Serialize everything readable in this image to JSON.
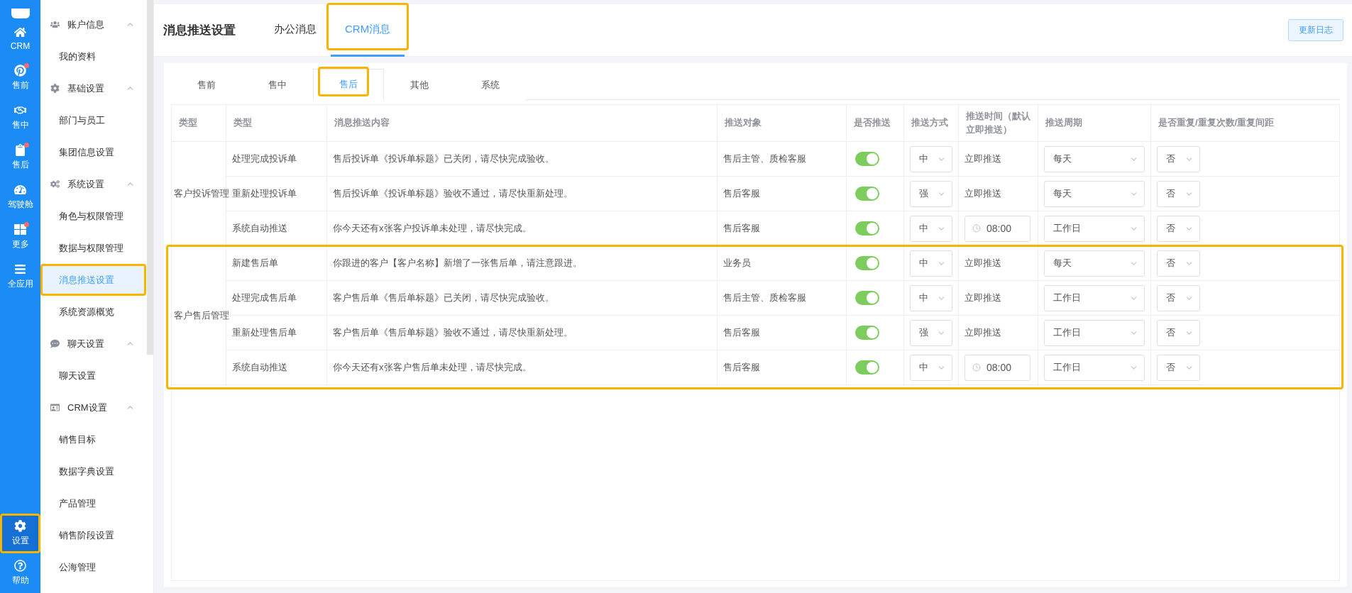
{
  "rail": {
    "items": [
      {
        "label": "CRM",
        "badge": false,
        "selected": false
      },
      {
        "label": "售前",
        "badge": true,
        "selected": false
      },
      {
        "label": "售中",
        "badge": false,
        "selected": false
      },
      {
        "label": "售后",
        "badge": true,
        "selected": false
      },
      {
        "label": "驾驶舱",
        "badge": false,
        "selected": false
      },
      {
        "label": "更多",
        "badge": true,
        "selected": false
      },
      {
        "label": "全应用",
        "badge": false,
        "selected": false
      }
    ],
    "bottom_items": [
      {
        "label": "设置",
        "badge": false,
        "selected": true,
        "highlighted": true
      },
      {
        "label": "帮助",
        "badge": false,
        "selected": false,
        "highlighted": false
      }
    ]
  },
  "sidebar": {
    "groups": [
      {
        "label": "账户信息",
        "expanded": true,
        "items": [
          {
            "label": "我的资料",
            "selected": false,
            "highlighted": false
          }
        ]
      },
      {
        "label": "基础设置",
        "expanded": true,
        "items": [
          {
            "label": "部门与员工",
            "selected": false,
            "highlighted": false
          },
          {
            "label": "集团信息设置",
            "selected": false,
            "highlighted": false
          }
        ]
      },
      {
        "label": "系统设置",
        "expanded": true,
        "items": [
          {
            "label": "角色与权限管理",
            "selected": false,
            "highlighted": false
          },
          {
            "label": "数据与权限管理",
            "selected": false,
            "highlighted": false
          },
          {
            "label": "消息推送设置",
            "selected": true,
            "highlighted": true
          },
          {
            "label": "系统资源概览",
            "selected": false,
            "highlighted": false
          }
        ]
      },
      {
        "label": "聊天设置",
        "expanded": true,
        "items": [
          {
            "label": "聊天设置",
            "selected": false,
            "highlighted": false
          }
        ]
      },
      {
        "label": "CRM设置",
        "expanded": true,
        "items": [
          {
            "label": "销售目标",
            "selected": false,
            "highlighted": false
          },
          {
            "label": "数据字典设置",
            "selected": false,
            "highlighted": false
          },
          {
            "label": "产品管理",
            "selected": false,
            "highlighted": false
          },
          {
            "label": "销售阶段设置",
            "selected": false,
            "highlighted": false
          },
          {
            "label": "公海管理",
            "selected": false,
            "highlighted": false
          }
        ]
      }
    ]
  },
  "header": {
    "title": "消息推送设置",
    "tabs": [
      {
        "label": "办公消息",
        "selected": false,
        "highlighted": false
      },
      {
        "label": "CRM消息",
        "selected": true,
        "highlighted": true
      }
    ],
    "button": "更新日志"
  },
  "subtabs": [
    {
      "label": "售前",
      "selected": false,
      "highlighted": false
    },
    {
      "label": "售中",
      "selected": false,
      "highlighted": false
    },
    {
      "label": "售后",
      "selected": true,
      "highlighted": true
    },
    {
      "label": "其他",
      "selected": false,
      "highlighted": false
    },
    {
      "label": "系统",
      "selected": false,
      "highlighted": false
    }
  ],
  "table": {
    "columns": [
      "类型",
      "类型",
      "消息推送内容",
      "推送对象",
      "是否推送",
      "推送方式",
      "推送时间（默认立即推送）",
      "推送周期",
      "是否重复/重复次数/重复间距"
    ],
    "groups": [
      {
        "label": "客户投诉管理",
        "highlighted": false,
        "rows": [
          {
            "type": "处理完成投诉单",
            "content": "售后投诉单《投诉单标题》已关闭，请尽快完成验收。",
            "target": "售后主管、质检客服",
            "push": true,
            "mode": "中",
            "time": {
              "kind": "text",
              "value": "立即推送"
            },
            "cycle": "每天",
            "repeat": "否"
          },
          {
            "type": "重新处理投诉单",
            "content": "售后投诉单《投诉单标题》验收不通过，请尽快重新处理。",
            "target": "售后客服",
            "push": true,
            "mode": "强",
            "time": {
              "kind": "text",
              "value": "立即推送"
            },
            "cycle": "每天",
            "repeat": "否"
          },
          {
            "type": "系统自动推送",
            "content": "你今天还有x张客户投诉单未处理，请尽快完成。",
            "target": "售后客服",
            "push": true,
            "mode": "中",
            "time": {
              "kind": "clock",
              "value": "08:00"
            },
            "cycle": "工作日",
            "repeat": "否"
          }
        ]
      },
      {
        "label": "客户售后管理",
        "highlighted": true,
        "rows": [
          {
            "type": "新建售后单",
            "content": "你跟进的客户【客户名称】新增了一张售后单，请注意跟进。",
            "target": "业务员",
            "push": true,
            "mode": "中",
            "time": {
              "kind": "text",
              "value": "立即推送"
            },
            "cycle": "每天",
            "repeat": "否"
          },
          {
            "type": "处理完成售后单",
            "content": "客户售后单《售后单标题》已关闭，请尽快完成验收。",
            "target": "售后主管、质检客服",
            "push": true,
            "mode": "中",
            "time": {
              "kind": "text",
              "value": "立即推送"
            },
            "cycle": "工作日",
            "repeat": "否"
          },
          {
            "type": "重新处理售后单",
            "content": "客户售后单《售后单标题》验收不通过，请尽快重新处理。",
            "target": "售后客服",
            "push": true,
            "mode": "强",
            "time": {
              "kind": "text",
              "value": "立即推送"
            },
            "cycle": "工作日",
            "repeat": "否"
          },
          {
            "type": "系统自动推送",
            "content": "你今天还有x张客户售后单未处理，请尽快完成。",
            "target": "售后客服",
            "push": true,
            "mode": "中",
            "time": {
              "kind": "clock",
              "value": "08:00"
            },
            "cycle": "工作日",
            "repeat": "否"
          }
        ]
      }
    ]
  }
}
